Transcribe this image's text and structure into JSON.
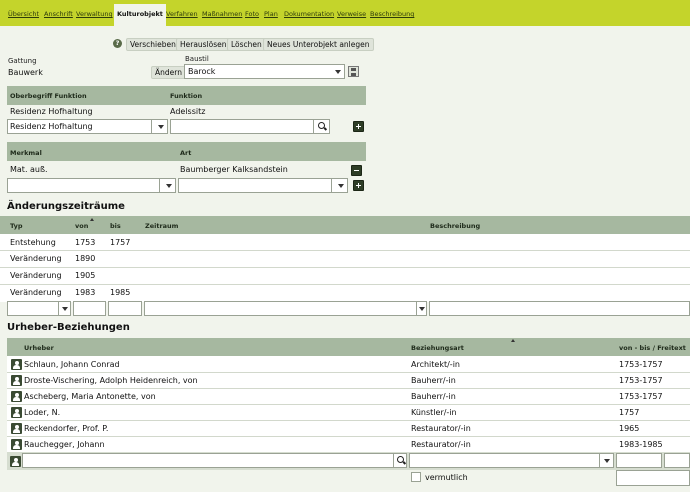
{
  "nav": {
    "tabs": [
      "Übersicht",
      "Anschrift",
      "Verwaltung",
      "Kulturobjekt",
      "Verfahren",
      "Maßnahmen",
      "Foto",
      "Plan",
      "Dokumentation",
      "Verweise",
      "Beschreibung"
    ]
  },
  "toolbar": {
    "verschieben": "Verschieben",
    "herausloesen": "Herauslösen",
    "loeschen": "Löschen",
    "neues_unterobjekt": "Neues Unterobjekt anlegen"
  },
  "gattung": {
    "label": "Gattung",
    "value": "Bauwerk",
    "aendern": "Ändern"
  },
  "baustil": {
    "label": "Baustil",
    "value": "Barock"
  },
  "funktion": {
    "headers": [
      "Oberbegriff Funktion",
      "Funktion"
    ],
    "row": [
      "Residenz Hofhaltung",
      "Adelssitz"
    ],
    "input_value": "Residenz Hofhaltung"
  },
  "merkmal": {
    "headers": [
      "Merkmal",
      "Art"
    ],
    "row": [
      "Mat. auß.",
      "Baumberger Kalksandstein"
    ]
  },
  "aenderung": {
    "title": "Änderungszeiträume",
    "headers": [
      "Typ",
      "von",
      "bis",
      "Zeitraum",
      "Beschreibung"
    ],
    "rows": [
      [
        "Entstehung",
        "1753",
        "1757"
      ],
      [
        "Veränderung",
        "1890",
        ""
      ],
      [
        "Veränderung",
        "1905",
        ""
      ],
      [
        "Veränderung",
        "1983",
        "1985"
      ]
    ]
  },
  "urheber": {
    "title": "Urheber-Beziehungen",
    "headers": [
      "Urheber",
      "Beziehungsart",
      "von - bis / Freitext"
    ],
    "rows": [
      [
        "Schlaun, Johann Conrad",
        "Architekt/-in",
        "1753-1757"
      ],
      [
        "Droste-Vischering, Adolph Heidenreich, von",
        "Bauherr/-in",
        "1753-1757"
      ],
      [
        "Ascheberg, Maria Antonette, von",
        "Bauherr/-in",
        "1753-1757"
      ],
      [
        "Loder, N.",
        "Künstler/-in",
        "1757"
      ],
      [
        "Reckendorfer, Prof. P.",
        "Restaurator/-in",
        "1965"
      ],
      [
        "Rauchegger, Johann",
        "Restaurator/-in",
        "1983-1985"
      ]
    ],
    "vermutlich": "vermutlich"
  }
}
